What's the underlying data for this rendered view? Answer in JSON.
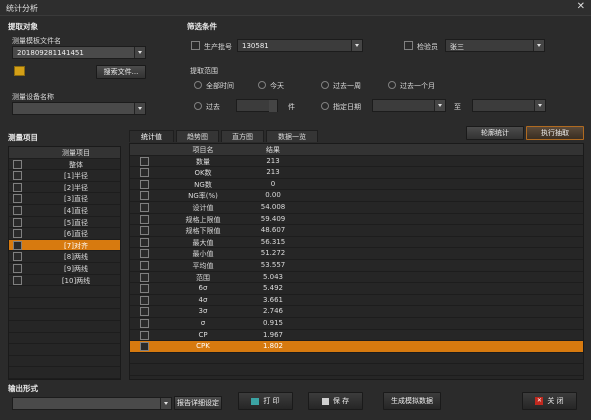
{
  "window": {
    "title": "统计分析",
    "close_glyph": "✕"
  },
  "extract": {
    "section_title": "提取对象",
    "template_label": "测量模板文件名",
    "template_value": "201809281141451",
    "search_button": "搜索文件...",
    "device_label": "测量设备名称",
    "device_value": ""
  },
  "filter": {
    "section_title": "筛选条件",
    "batch_label": "生产批号",
    "batch_value": "130581",
    "inspector_label": "检验员",
    "inspector_value": "张三",
    "range_title": "提取范围",
    "radios": [
      "全部时间",
      "今天",
      "过去一周",
      "过去一个月"
    ],
    "past_label": "过去",
    "past_unit": "件",
    "date_label": "指定日期",
    "to_label": "至"
  },
  "measure": {
    "section_title": "测量项目",
    "header": "测量项目",
    "items": [
      "整体",
      "[1]半径",
      "[2]半径",
      "[3]直径",
      "[4]直径",
      "[5]直径",
      "[6]直径",
      "[7]对齐",
      "[8]两线",
      "[9]两线",
      "[10]两线"
    ],
    "selected_index": 7
  },
  "tabs": [
    "统计值",
    "趋势图",
    "直方图",
    "数据一览"
  ],
  "actions": {
    "round_stats": "轮廓统计",
    "execute": "执行抽取"
  },
  "stats": {
    "col_item": "项目名",
    "col_result": "结果",
    "rows": [
      [
        "数量",
        "213"
      ],
      [
        "OK数",
        "213"
      ],
      [
        "NG数",
        "0"
      ],
      [
        "NG率(%)",
        "0.00"
      ],
      [
        "设计值",
        "54.008"
      ],
      [
        "规格上限值",
        "59.409"
      ],
      [
        "规格下限值",
        "48.607"
      ],
      [
        "最大值",
        "56.315"
      ],
      [
        "最小值",
        "51.272"
      ],
      [
        "平均值",
        "53.557"
      ],
      [
        "范围",
        "5.043"
      ],
      [
        "6σ",
        "5.492"
      ],
      [
        "4σ",
        "3.661"
      ],
      [
        "3σ",
        "2.746"
      ],
      [
        "σ",
        "0.915"
      ],
      [
        "CP",
        "1.967"
      ],
      [
        "CPK",
        "1.802"
      ]
    ],
    "selected_index": 16
  },
  "output": {
    "section_title": "输出形式",
    "format_value": "",
    "report_button": "报告详细设定",
    "print_button": "打 印",
    "save_button": "保 存",
    "mock_button": "生成模拟数据",
    "close_button": "关 闭"
  },
  "colors": {
    "accent": "#d77a0f",
    "background": "#2b2b2b"
  }
}
